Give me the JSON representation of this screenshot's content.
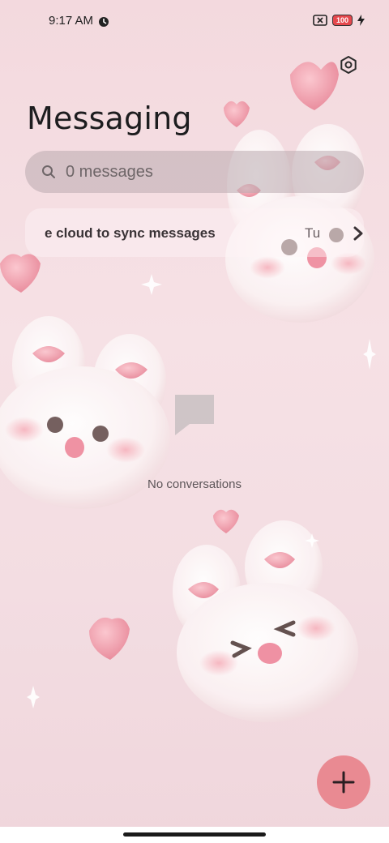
{
  "status_bar": {
    "time": "9:17 AM",
    "battery": "100",
    "icons": [
      "data-saver-icon",
      "sim-off-icon",
      "battery-icon",
      "charging-icon"
    ]
  },
  "header": {
    "title": "Messaging",
    "settings_icon": "settings-icon"
  },
  "search": {
    "placeholder": "0 messages"
  },
  "sync_banner": {
    "text": "e cloud to sync messages",
    "cta": "Tu",
    "arrow_icon": "chevron-right-icon"
  },
  "empty_state": {
    "icon": "message-bubble-icon",
    "text": "No conversations"
  },
  "fab": {
    "icon": "plus-icon"
  },
  "colors": {
    "accent": "#e98a92",
    "background": "#f3d9de",
    "heart": "#ef9aa8"
  }
}
